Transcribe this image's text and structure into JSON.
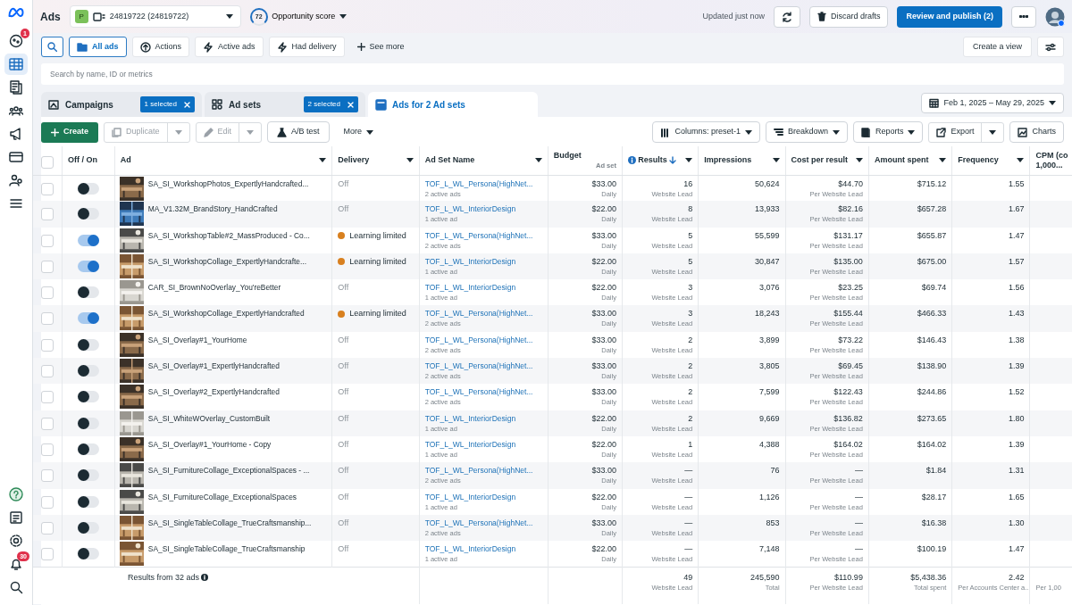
{
  "sidebar": {
    "items": [
      {
        "kind": "notifications",
        "selected": false,
        "badge": "1"
      },
      {
        "kind": "table",
        "selected": true
      },
      {
        "kind": "pages",
        "selected": false
      },
      {
        "kind": "audience",
        "selected": false
      },
      {
        "kind": "campaign",
        "selected": false
      },
      {
        "kind": "billing",
        "selected": false
      },
      {
        "kind": "network",
        "selected": false
      },
      {
        "kind": "menu",
        "selected": false
      }
    ],
    "bottom_items": [
      {
        "kind": "help",
        "selected": false
      },
      {
        "kind": "document",
        "selected": false
      },
      {
        "kind": "settings",
        "selected": false
      },
      {
        "kind": "alerts",
        "selected": false,
        "badge": "30"
      },
      {
        "kind": "search",
        "selected": false
      }
    ]
  },
  "header": {
    "title": "Ads",
    "account_initial": "P",
    "account": "24819722 (24819722)",
    "score": "72",
    "score_label": "Opportunity score",
    "updated": "Updated just now",
    "discard": "Discard drafts",
    "publish": "Review and publish (2)"
  },
  "filters": [
    {
      "label": "All ads",
      "selected": true
    },
    {
      "label": "Actions",
      "selected": false
    },
    {
      "label": "Active ads",
      "selected": false
    },
    {
      "label": "Had delivery",
      "selected": false
    }
  ],
  "see_more": "See more",
  "create_view": "Create a view",
  "search": {
    "placeholder": "Search by name, ID or metrics"
  },
  "levels": [
    {
      "label": "Campaigns",
      "badge": "1 selected",
      "selected": false
    },
    {
      "label": "Ad sets",
      "badge": "2 selected",
      "selected": false
    },
    {
      "label": "Ads for 2 Ad sets",
      "selected": true
    }
  ],
  "date_range": "Feb 1, 2025 – May 29, 2025",
  "toolbar": {
    "create": "Create",
    "duplicate": {
      "label": "Duplicate",
      "disabled": true
    },
    "edit": {
      "label": "Edit",
      "disabled": true
    },
    "ab_test": "A/B test",
    "more": "More",
    "columns": "Columns: preset-1",
    "breakdown": "Breakdown",
    "reports": "Reports",
    "export": "Export",
    "charts": "Charts"
  },
  "table": {
    "all_selected": false,
    "columns": [
      {
        "label": "Off / On",
        "sorted": false
      },
      {
        "label": "Ad",
        "sorted": false
      },
      {
        "label": "Delivery",
        "sorted": false
      },
      {
        "label": "Ad Set Name",
        "sorted": false
      },
      {
        "label": "Budget",
        "sub": "Ad set",
        "sorted": false
      },
      {
        "label": "Results",
        "sorted": true
      },
      {
        "label": "Impressions",
        "sorted": false
      },
      {
        "label": "Cost per result",
        "sorted": false
      },
      {
        "label": "Amount spent",
        "sorted": false
      },
      {
        "label": "Frequency",
        "sorted": false
      },
      {
        "label": "CPM (co",
        "label_2": "1,000...",
        "sorted": false
      }
    ],
    "rows": [
      {
        "selected": false,
        "on": false,
        "ad": "SA_SI_WorkshopPhotos_ExpertlyHandcrafted...",
        "delivery": {
          "label": "Off",
          "kind": "off"
        },
        "ad_set": "TOF_L_WL_Persona(HighNet...",
        "ad_set_sub": "2 active ads",
        "budget": "$33.00",
        "budget_period": "Daily",
        "results": "16",
        "results_sub": "Website Lead",
        "impressions": "50,624",
        "cost": "$44.70",
        "cost_sub": "Per Website Lead",
        "spent": "$715.12",
        "frequency": "1.55"
      },
      {
        "selected": false,
        "on": false,
        "ad": "MA_V1.32M_BrandStory_HandCrafted",
        "delivery": {
          "label": "Off",
          "kind": "off"
        },
        "ad_set": "TOF_L_WL_InteriorDesign",
        "ad_set_sub": "1 active ad",
        "budget": "$22.00",
        "budget_period": "Daily",
        "results": "8",
        "results_sub": "Website Lead",
        "impressions": "13,933",
        "cost": "$82.16",
        "cost_sub": "Per Website Lead",
        "spent": "$657.28",
        "frequency": "1.67"
      },
      {
        "selected": false,
        "on": true,
        "ad": "SA_SI_WorkshopTable#2_MassProduced - Co...",
        "delivery": {
          "label": "Learning limited",
          "kind": "learning"
        },
        "ad_set": "TOF_L_WL_Persona(HighNet...",
        "ad_set_sub": "2 active ads",
        "budget": "$33.00",
        "budget_period": "Daily",
        "results": "5",
        "results_sub": "Website Lead",
        "impressions": "55,599",
        "cost": "$131.17",
        "cost_sub": "Per Website Lead",
        "spent": "$655.87",
        "frequency": "1.47"
      },
      {
        "selected": false,
        "on": true,
        "ad": "SA_SI_WorkshopCollage_ExpertlyHandcrafte...",
        "delivery": {
          "label": "Learning limited",
          "kind": "learning"
        },
        "ad_set": "TOF_L_WL_InteriorDesign",
        "ad_set_sub": "1 active ad",
        "budget": "$22.00",
        "budget_period": "Daily",
        "results": "5",
        "results_sub": "Website Lead",
        "impressions": "30,847",
        "cost": "$135.00",
        "cost_sub": "Per Website Lead",
        "spent": "$675.00",
        "frequency": "1.57"
      },
      {
        "selected": false,
        "on": false,
        "ad": "CAR_SI_BrownNoOverlay_You'reBetter",
        "delivery": {
          "label": "Off",
          "kind": "off"
        },
        "ad_set": "TOF_L_WL_InteriorDesign",
        "ad_set_sub": "1 active ad",
        "budget": "$22.00",
        "budget_period": "Daily",
        "results": "3",
        "results_sub": "Website Lead",
        "impressions": "3,076",
        "cost": "$23.25",
        "cost_sub": "Per Website Lead",
        "spent": "$69.74",
        "frequency": "1.56"
      },
      {
        "selected": false,
        "on": true,
        "ad": "SA_SI_WorkshopCollage_ExpertlyHandcrafted",
        "delivery": {
          "label": "Learning limited",
          "kind": "learning"
        },
        "ad_set": "TOF_L_WL_Persona(HighNet...",
        "ad_set_sub": "2 active ads",
        "budget": "$33.00",
        "budget_period": "Daily",
        "results": "3",
        "results_sub": "Website Lead",
        "impressions": "18,243",
        "cost": "$155.44",
        "cost_sub": "Per Website Lead",
        "spent": "$466.33",
        "frequency": "1.43"
      },
      {
        "selected": false,
        "on": false,
        "ad": "SA_SI_Overlay#1_YourHome",
        "delivery": {
          "label": "Off",
          "kind": "off"
        },
        "ad_set": "TOF_L_WL_Persona(HighNet...",
        "ad_set_sub": "2 active ads",
        "budget": "$33.00",
        "budget_period": "Daily",
        "results": "2",
        "results_sub": "Website Lead",
        "impressions": "3,899",
        "cost": "$73.22",
        "cost_sub": "Per Website Lead",
        "spent": "$146.43",
        "frequency": "1.38"
      },
      {
        "selected": false,
        "on": false,
        "ad": "SA_SI_Overlay#1_ExpertlyHandcrafted",
        "delivery": {
          "label": "Off",
          "kind": "off"
        },
        "ad_set": "TOF_L_WL_Persona(HighNet...",
        "ad_set_sub": "2 active ads",
        "budget": "$33.00",
        "budget_period": "Daily",
        "results": "2",
        "results_sub": "Website Lead",
        "impressions": "3,805",
        "cost": "$69.45",
        "cost_sub": "Per Website Lead",
        "spent": "$138.90",
        "frequency": "1.39"
      },
      {
        "selected": false,
        "on": false,
        "ad": "SA_SI_Overlay#2_ExpertlyHandcrafted",
        "delivery": {
          "label": "Off",
          "kind": "off"
        },
        "ad_set": "TOF_L_WL_Persona(HighNet...",
        "ad_set_sub": "2 active ads",
        "budget": "$33.00",
        "budget_period": "Daily",
        "results": "2",
        "results_sub": "Website Lead",
        "impressions": "7,599",
        "cost": "$122.43",
        "cost_sub": "Per Website Lead",
        "spent": "$244.86",
        "frequency": "1.52"
      },
      {
        "selected": false,
        "on": false,
        "ad": "SA_SI_WhiteWOverlay_CustomBuilt",
        "delivery": {
          "label": "Off",
          "kind": "off"
        },
        "ad_set": "TOF_L_WL_InteriorDesign",
        "ad_set_sub": "1 active ad",
        "budget": "$22.00",
        "budget_period": "Daily",
        "results": "2",
        "results_sub": "Website Lead",
        "impressions": "9,669",
        "cost": "$136.82",
        "cost_sub": "Per Website Lead",
        "spent": "$273.65",
        "frequency": "1.80"
      },
      {
        "selected": false,
        "on": false,
        "ad": "SA_SI_Overlay#1_YourHome - Copy",
        "delivery": {
          "label": "Off",
          "kind": "off"
        },
        "ad_set": "TOF_L_WL_InteriorDesign",
        "ad_set_sub": "1 active ad",
        "budget": "$22.00",
        "budget_period": "Daily",
        "results": "1",
        "results_sub": "Website Lead",
        "impressions": "4,388",
        "cost": "$164.02",
        "cost_sub": "Per Website Lead",
        "spent": "$164.02",
        "frequency": "1.39"
      },
      {
        "selected": false,
        "on": false,
        "ad": "SA_SI_FurnitureCollage_ExceptionalSpaces - ...",
        "delivery": {
          "label": "Off",
          "kind": "off"
        },
        "ad_set": "TOF_L_WL_Persona(HighNet...",
        "ad_set_sub": "2 active ads",
        "budget": "$33.00",
        "budget_period": "Daily",
        "results": "—",
        "results_sub": "Website Lead",
        "impressions": "76",
        "cost": "—",
        "cost_sub": "Per Website Lead",
        "spent": "$1.84",
        "frequency": "1.31"
      },
      {
        "selected": false,
        "on": false,
        "ad": "SA_SI_FurnitureCollage_ExceptionalSpaces",
        "delivery": {
          "label": "Off",
          "kind": "off"
        },
        "ad_set": "TOF_L_WL_InteriorDesign",
        "ad_set_sub": "1 active ad",
        "budget": "$22.00",
        "budget_period": "Daily",
        "results": "—",
        "results_sub": "Website Lead",
        "impressions": "1,126",
        "cost": "—",
        "cost_sub": "Per Website Lead",
        "spent": "$28.17",
        "frequency": "1.65"
      },
      {
        "selected": false,
        "on": false,
        "ad": "SA_SI_SingleTableCollage_TrueCraftsmanship...",
        "delivery": {
          "label": "Off",
          "kind": "off"
        },
        "ad_set": "TOF_L_WL_Persona(HighNet...",
        "ad_set_sub": "2 active ads",
        "budget": "$33.00",
        "budget_period": "Daily",
        "results": "—",
        "results_sub": "Website Lead",
        "impressions": "853",
        "cost": "—",
        "cost_sub": "Per Website Lead",
        "spent": "$16.38",
        "frequency": "1.30"
      },
      {
        "selected": false,
        "on": false,
        "ad": "SA_SI_SingleTableCollage_TrueCraftsmanship",
        "delivery": {
          "label": "Off",
          "kind": "off"
        },
        "ad_set": "TOF_L_WL_InteriorDesign",
        "ad_set_sub": "1 active ad",
        "budget": "$22.00",
        "budget_period": "Daily",
        "results": "—",
        "results_sub": "Website Lead",
        "impressions": "7,148",
        "cost": "—",
        "cost_sub": "Per Website Lead",
        "spent": "$100.19",
        "frequency": "1.47"
      }
    ],
    "footer": {
      "label": "Results from 32 ads",
      "results": "49",
      "results_sub": "Website Lead",
      "impressions": "245,590",
      "impressions_sub": "Total",
      "cost": "$110.99",
      "cost_sub": "Per Website Lead",
      "spent": "$5,438.36",
      "spent_sub": "Total spent",
      "frequency": "2.42",
      "frequency_sub": "Per Accounts Center a...",
      "cpm_sub": "Per 1,00"
    }
  }
}
